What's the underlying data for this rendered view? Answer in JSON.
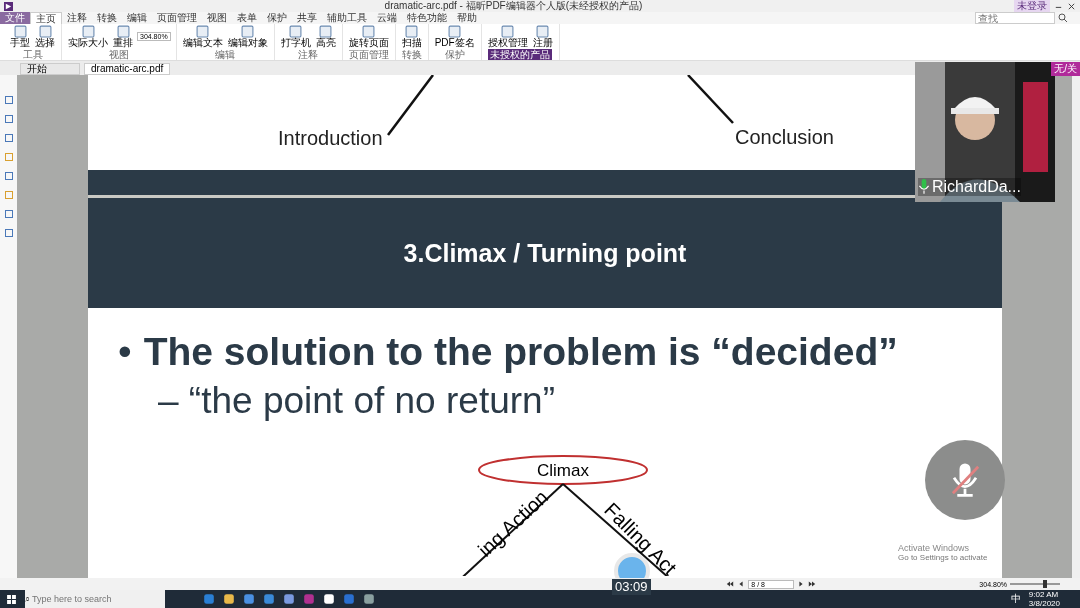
{
  "window": {
    "title": "dramatic-arc.pdf - 福昕PDF编辑器个人版(未经授权的产品)",
    "account": "未登录"
  },
  "ribbon_tabs": [
    {
      "label": "文件",
      "selected": false,
      "kind": "file"
    },
    {
      "label": "主页",
      "selected": true,
      "kind": "tab"
    },
    {
      "label": "注释",
      "selected": false,
      "kind": "tab"
    },
    {
      "label": "转换",
      "selected": false,
      "kind": "tab"
    },
    {
      "label": "编辑",
      "selected": false,
      "kind": "tab"
    },
    {
      "label": "页面管理",
      "selected": false,
      "kind": "tab"
    },
    {
      "label": "视图",
      "selected": false,
      "kind": "tab"
    },
    {
      "label": "表单",
      "selected": false,
      "kind": "tab"
    },
    {
      "label": "保护",
      "selected": false,
      "kind": "tab"
    },
    {
      "label": "共享",
      "selected": false,
      "kind": "tab"
    },
    {
      "label": "辅助工具",
      "selected": false,
      "kind": "tab"
    },
    {
      "label": "云端",
      "selected": false,
      "kind": "tab"
    },
    {
      "label": "特色功能",
      "selected": false,
      "kind": "tab"
    },
    {
      "label": "帮助",
      "selected": false,
      "kind": "tab"
    }
  ],
  "ribbon_groups": [
    {
      "label": "工具",
      "tools": [
        "手型",
        "选择"
      ],
      "highlighted": false
    },
    {
      "label": "视图",
      "tools": [
        "实际大小",
        "重排"
      ],
      "highlighted": false
    },
    {
      "label": "编辑",
      "tools": [
        "编辑文本",
        "编辑对象"
      ],
      "highlighted": false
    },
    {
      "label": "注释",
      "tools": [
        "打字机",
        "高亮"
      ],
      "highlighted": false
    },
    {
      "label": "页面管理",
      "tools": [
        "旋转页面"
      ],
      "highlighted": false
    },
    {
      "label": "转换",
      "tools": [
        "扫描"
      ],
      "highlighted": false
    },
    {
      "label": "保护",
      "tools": [
        "PDF签名"
      ],
      "highlighted": false
    },
    {
      "label": "未授权的产品",
      "tools": [
        "授权管理",
        "注册"
      ],
      "highlighted": true
    }
  ],
  "zoom_field": "304.80%",
  "search": {
    "placeholder": "查找"
  },
  "doc_tabs": [
    {
      "label": "开始",
      "selected": false
    },
    {
      "label": "dramatic-arc.pdf",
      "selected": true
    }
  ],
  "page_top": {
    "left_label": "Introduction",
    "right_label": "Conclusion"
  },
  "slide": {
    "title": "3.Climax / Turning point",
    "bullet_mark": "•",
    "bullet": "The solution to the problem is “decided”",
    "sub_bullet": "– “the point of no return”",
    "diagram": {
      "top": "Climax",
      "left": "ing Action",
      "right": "Falling Act"
    }
  },
  "webcam": {
    "name": "RichardDa..."
  },
  "mic_muted": true,
  "watermark_free_notice": {
    "line1": "Activate Windows",
    "line2": "Go to Settings to activate"
  },
  "side_badge": "无/关",
  "status": {
    "page": "8 / 8",
    "zoom": "304.80%",
    "level": 0.7
  },
  "recording_time": "03:09",
  "taskbar": {
    "search_mark": "⌕",
    "search_placeholder": "Type here to search",
    "time": "9:02 AM",
    "date": "3/8/2020",
    "ime": "中"
  }
}
